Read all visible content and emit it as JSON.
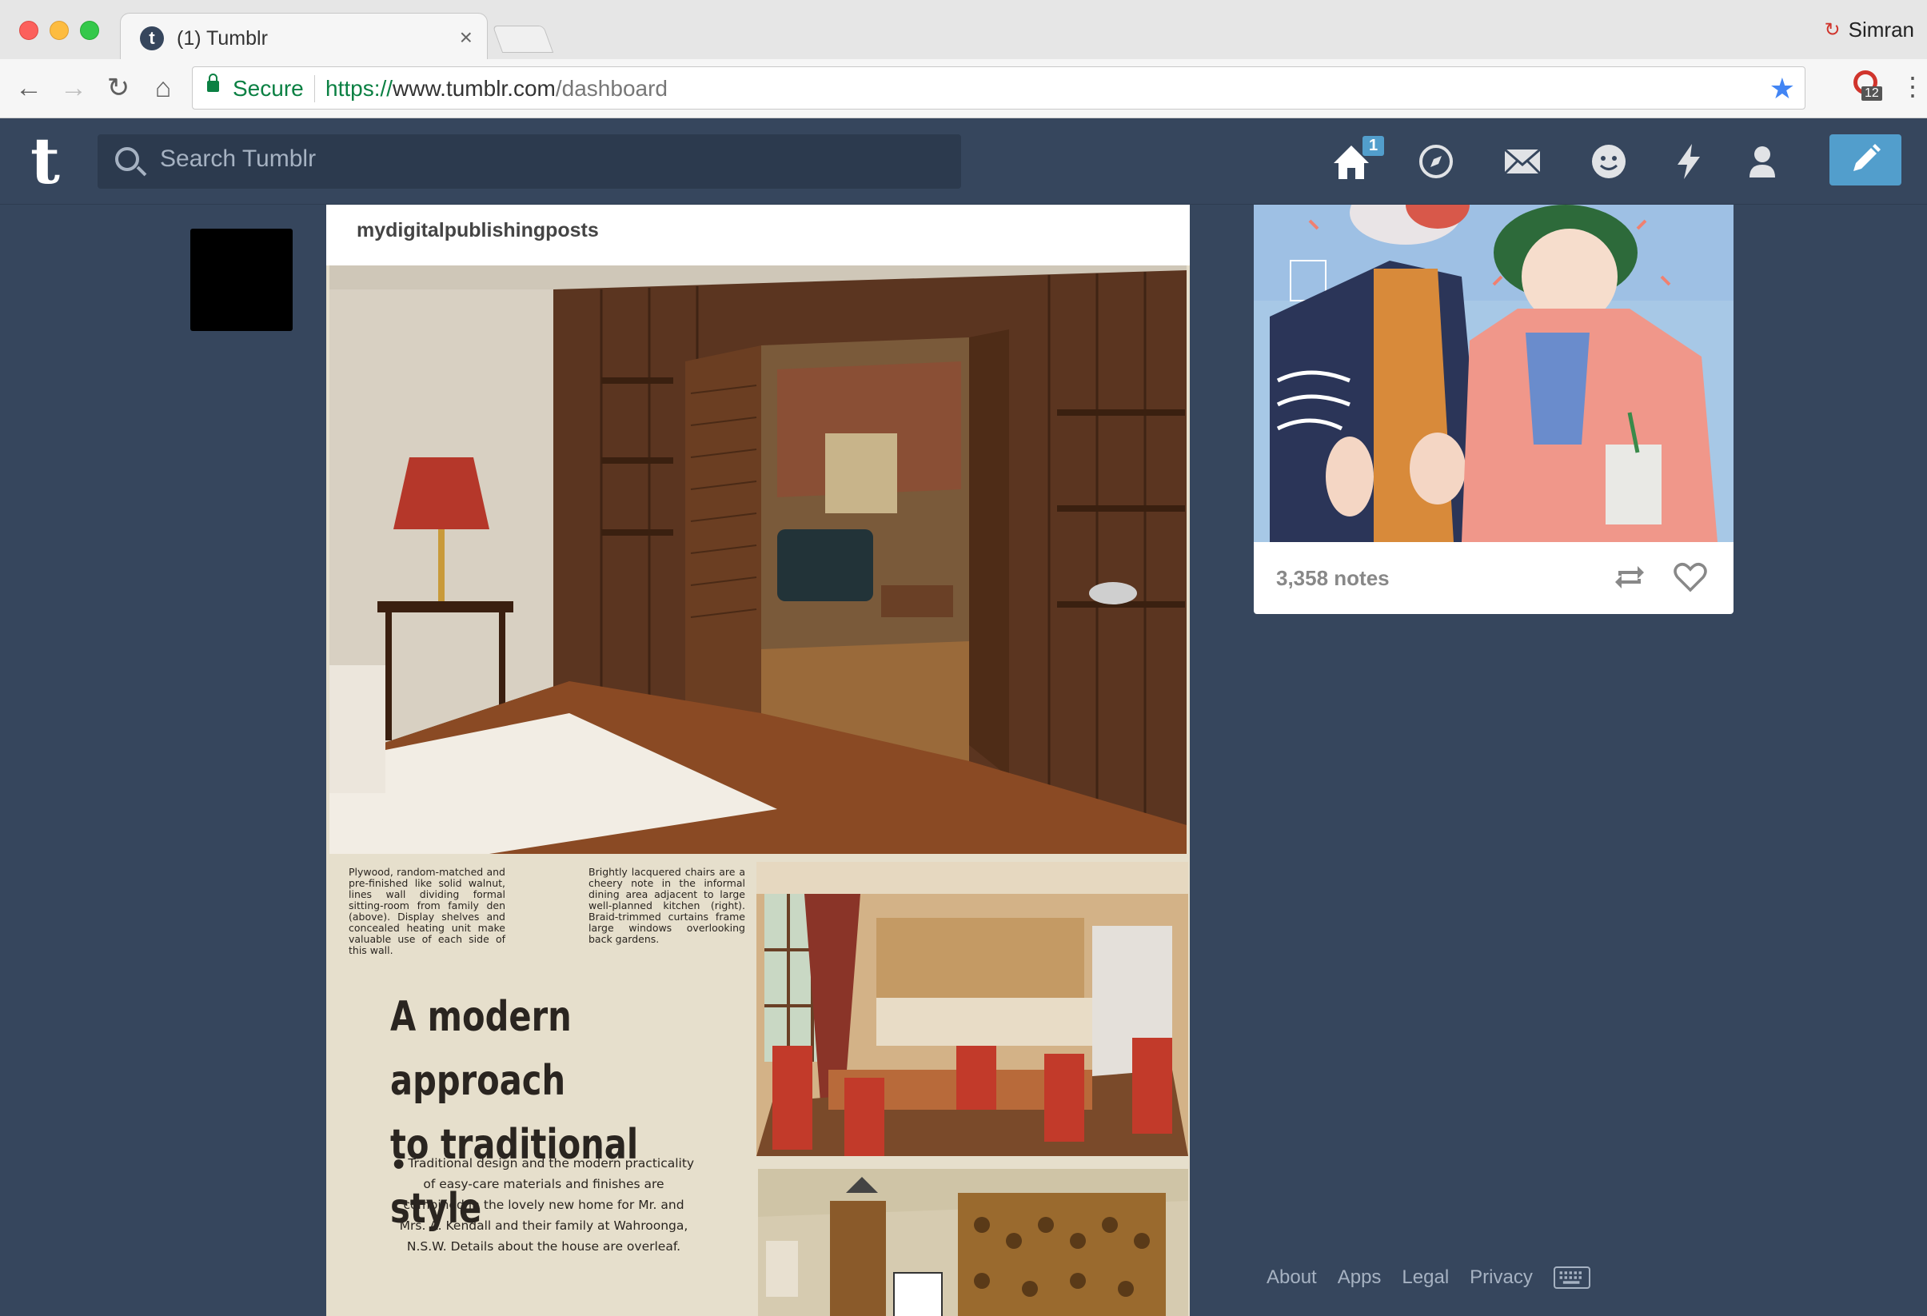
{
  "browser": {
    "tab_title": "(1) Tumblr",
    "tab_close": "×",
    "user_name": "Simran",
    "secure_label": "Secure",
    "url_scheme": "https://",
    "url_host": "www.tumblr.com",
    "url_path": "/dashboard",
    "extension_badge": "12"
  },
  "header": {
    "logo": "t",
    "search_placeholder": "Search Tumblr",
    "home_badge": "1",
    "colors": {
      "background": "#36465d",
      "accent": "#529ecc"
    },
    "icons": [
      "home-icon",
      "explore-icon",
      "inbox-icon",
      "messaging-icon",
      "activity-icon",
      "account-icon",
      "compose-icon"
    ]
  },
  "main_post": {
    "blog_name": "mydigitalpublishingposts",
    "image": {
      "caption_left": "Plywood, random-matched and pre-finished like solid walnut, lines wall dividing formal sitting-room from family den (above). Display shelves and concealed heating unit make valuable use of each side of this wall.",
      "caption_right": "Brightly lacquered chairs are a cheery note in the informal dining area adjacent to large well-planned kitchen (right). Braid-trimmed curtains frame large windows overlooking back gardens.",
      "title_line1": "A modern approach",
      "title_line2": "to traditional style",
      "body": "● Traditional design and the modern practicality of easy-care materials and finishes are combined in the lovely new home for Mr. and Mrs. A. Kendall and their family at Wahroonga, N.S.W. Details about the house are overleaf."
    }
  },
  "side_post": {
    "notes": "3,358 notes"
  },
  "footer": {
    "links": [
      "About",
      "Apps",
      "Legal",
      "Privacy"
    ]
  }
}
